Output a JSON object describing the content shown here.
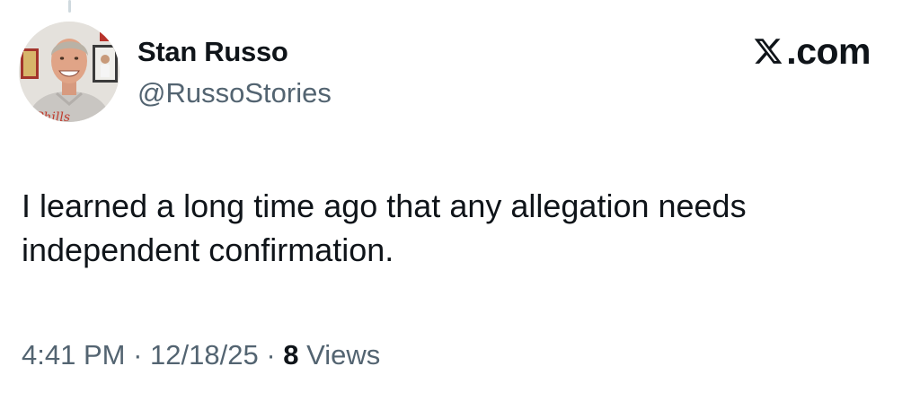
{
  "tweet": {
    "author": {
      "display_name": "Stan Russo",
      "handle": "@RussoStories",
      "avatar_icon": "profile-photo"
    },
    "brand": {
      "icon": "x-logo-icon",
      "text": ".com"
    },
    "text": "I learned a long time ago that any allegation needs\nindependent confirmation.",
    "meta": {
      "time": "4:41 PM",
      "separator": "·",
      "date": "12/18/25",
      "views_count": "8",
      "views_label": "Views"
    }
  },
  "colors": {
    "text_primary": "#0f1419",
    "text_secondary": "#536471",
    "thread_line": "#cfd9de",
    "background": "#ffffff"
  }
}
